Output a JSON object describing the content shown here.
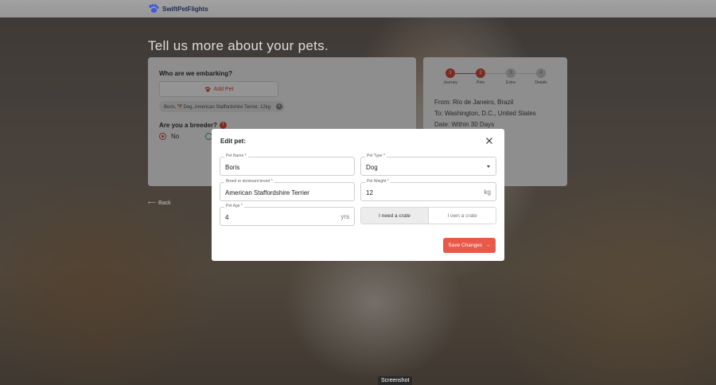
{
  "app": {
    "name": "SwiftPetFlights"
  },
  "page": {
    "heading": "Tell us more about your pets."
  },
  "pets_card": {
    "question_embarking": "Who are we embarking?",
    "add_pet_label": "Add Pet",
    "pet_chip": "Boris, 🐕Dog, American Staffordshire Terrier, 12kg",
    "question_breeder": "Are you a breeder?",
    "breeder_info": "!",
    "no_label": "No"
  },
  "progress": {
    "steps": [
      {
        "number": "1",
        "label": "Journey"
      },
      {
        "number": "2",
        "label": "Pets"
      },
      {
        "number": "3",
        "label": "Extra"
      },
      {
        "number": "4",
        "label": "Details"
      }
    ]
  },
  "trip": {
    "from": "From: Rio de Janeiro, Brazil",
    "to": "To: Washington, D.C., United States",
    "date": "Date: Within 30 Days"
  },
  "back_label": "Back",
  "modal": {
    "title": "Edit pet:",
    "pet_name": {
      "label": "Pet Name *",
      "value": "Boris"
    },
    "pet_type": {
      "label": "Pet Type *",
      "value": "Dog"
    },
    "breed": {
      "label": "Breed or dominant breed *",
      "value": "American Staffordshire Terrier"
    },
    "weight": {
      "label": "Pet Weight *",
      "value": "12",
      "unit": "kg"
    },
    "age": {
      "label": "Pet Age *",
      "value": "4",
      "unit": "yrs"
    },
    "crate_need": "I need a crate",
    "crate_own": "I own a crate",
    "save_label": "Save Changes"
  },
  "tooltip": "Screenshot",
  "colors": {
    "accent": "#e8594a",
    "brand": "#1f2a55"
  }
}
